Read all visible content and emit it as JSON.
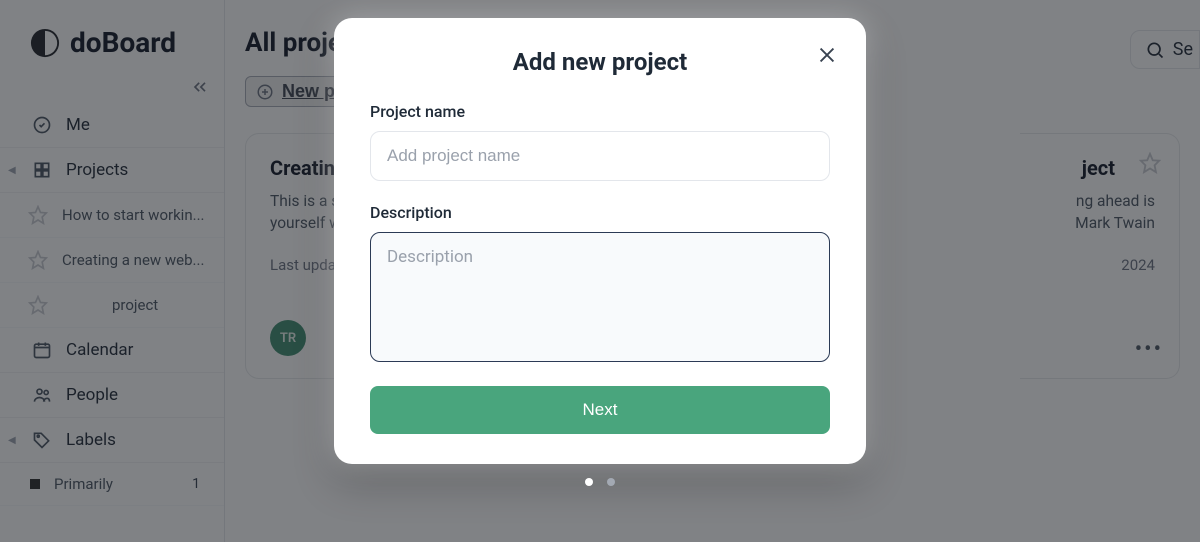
{
  "brand": {
    "name": "doBoard"
  },
  "search": {
    "label": "Se"
  },
  "sidebar": {
    "me": "Me",
    "projects": "Projects",
    "sub_projects": [
      "How to start workin...",
      "Creating a new web...",
      "project"
    ],
    "calendar": "Calendar",
    "people": "People",
    "labels": "Labels",
    "label_items": [
      {
        "name": "Primarily",
        "count": "1"
      }
    ]
  },
  "main": {
    "title": "All projects",
    "new_project_btn": "New project"
  },
  "cards": [
    {
      "title": "Creating a new website(Example)",
      "desc": "This is a small example of using doBoard to familiarize yourself with the service's capabilities.",
      "meta": "Last update",
      "avatar": "TR"
    },
    {
      "title_suffix": "ject",
      "line1_suffix": "ng ahead is",
      "line2_suffix": "Mark Twain",
      "date_suffix": "2024"
    }
  ],
  "modal": {
    "title": "Add new project",
    "name_label": "Project name",
    "name_placeholder": "Add project name",
    "desc_label": "Description",
    "desc_placeholder": "Description",
    "next": "Next"
  }
}
